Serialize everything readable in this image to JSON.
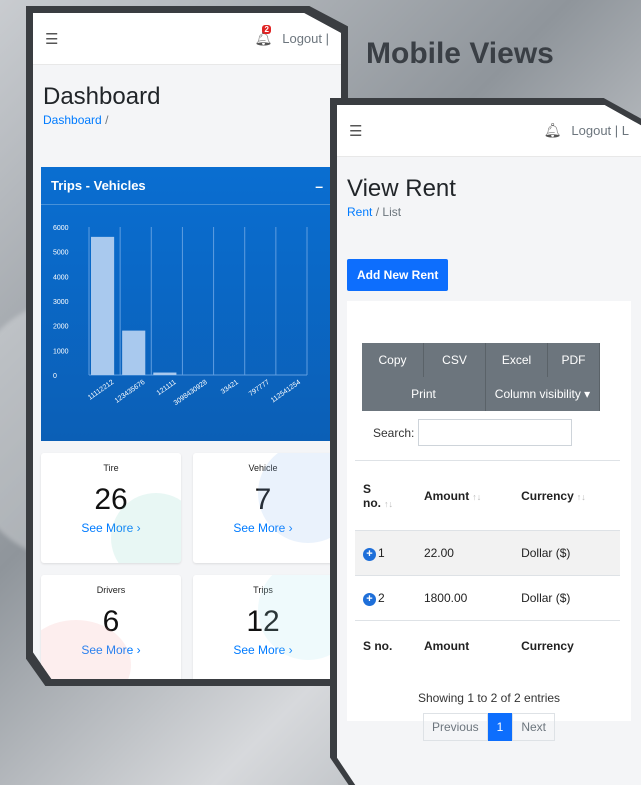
{
  "heading": "Mobile Views",
  "dashboard": {
    "logout_label": "Logout |",
    "notification_count": "2",
    "title": "Dashboard",
    "breadcrumb": {
      "link": "Dashboard",
      "sep": "/"
    },
    "chart_card": {
      "title": "Trips - Vehicles",
      "collapse_symbol": "–"
    },
    "tiles": [
      {
        "label": "Tire",
        "value": "26",
        "more": "See More ›"
      },
      {
        "label": "Vehicle",
        "value": "7",
        "more": "See More ›"
      },
      {
        "label": "Drivers",
        "value": "6",
        "more": "See More ›"
      },
      {
        "label": "Trips",
        "value": "12",
        "more": "See More ›"
      }
    ]
  },
  "chart_data": {
    "type": "bar",
    "categories": [
      "11112212",
      "123435676",
      "121111",
      "3098430928",
      "33421",
      "797777",
      "112541254"
    ],
    "values": [
      5600,
      1800,
      100,
      0,
      0,
      0,
      0
    ],
    "ylim": [
      0,
      6000
    ],
    "yticks": [
      "0",
      "1000",
      "2000",
      "3000",
      "4000",
      "5000",
      "6000"
    ],
    "colors": {
      "bar": "#a9c9ee",
      "grid": "#5f9de0"
    }
  },
  "rent": {
    "logout_label": "Logout | L",
    "title": "View Rent",
    "breadcrumb": {
      "link": "Rent",
      "sep": "/",
      "current": "List"
    },
    "add_button": "Add New Rent",
    "buttons": {
      "copy": "Copy",
      "csv": "CSV",
      "excel": "Excel",
      "pdf": "PDF",
      "print": "Print",
      "colvis": "Column visibility ▾"
    },
    "search_label": "Search:",
    "headers": {
      "sno_top": "S",
      "sno_bottom": "no.",
      "amount": "Amount",
      "currency": "Currency"
    },
    "rows": [
      {
        "sno": "1",
        "amount": "22.00",
        "currency": "Dollar ($)"
      },
      {
        "sno": "2",
        "amount": "1800.00",
        "currency": "Dollar ($)"
      }
    ],
    "footer": {
      "sno": "S no.",
      "amount": "Amount",
      "currency": "Currency"
    },
    "info": "Showing 1 to 2 of 2 entries",
    "pager": {
      "prev": "Previous",
      "page": "1",
      "next": "Next"
    }
  }
}
